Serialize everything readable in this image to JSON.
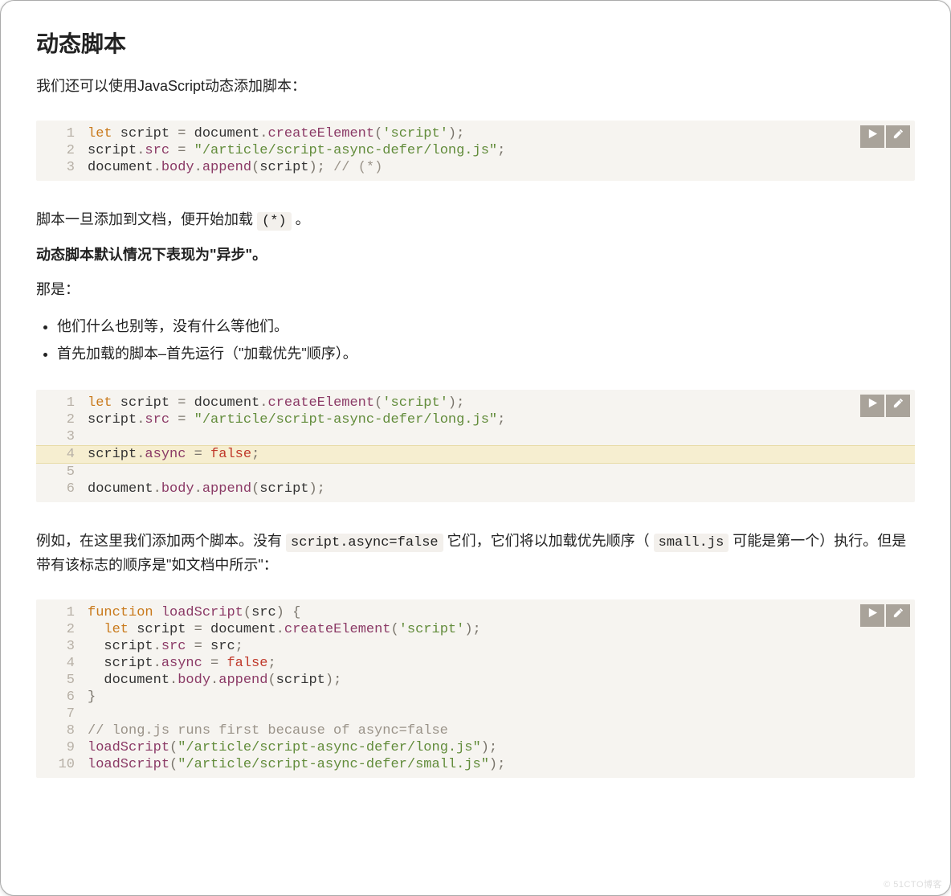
{
  "title": "动态脚本",
  "intro": "我们还可以使用JavaScript动态添加脚本：",
  "code1": {
    "lines": [
      {
        "n": "1",
        "tokens": [
          [
            "kw",
            "let"
          ],
          [
            "id",
            " script "
          ],
          [
            "punc",
            "="
          ],
          [
            "id",
            " document"
          ],
          [
            "punc",
            "."
          ],
          [
            "func",
            "createElement"
          ],
          [
            "punc",
            "("
          ],
          [
            "str",
            "'script'"
          ],
          [
            "punc",
            ");"
          ]
        ]
      },
      {
        "n": "2",
        "tokens": [
          [
            "id",
            "script"
          ],
          [
            "punc",
            "."
          ],
          [
            "prop",
            "src"
          ],
          [
            "id",
            " "
          ],
          [
            "punc",
            "="
          ],
          [
            "id",
            " "
          ],
          [
            "str",
            "\"/article/script-async-defer/long.js\""
          ],
          [
            "punc",
            ";"
          ]
        ]
      },
      {
        "n": "3",
        "tokens": [
          [
            "id",
            "document"
          ],
          [
            "punc",
            "."
          ],
          [
            "prop",
            "body"
          ],
          [
            "punc",
            "."
          ],
          [
            "func",
            "append"
          ],
          [
            "punc",
            "("
          ],
          [
            "id",
            "script"
          ],
          [
            "punc",
            ");"
          ],
          [
            "id",
            " "
          ],
          [
            "cmt",
            "// (*)"
          ]
        ]
      }
    ]
  },
  "p2_pre": "脚本一旦添加到文档，便开始加载 ",
  "p2_code": "(*)",
  "p2_post": " 。",
  "p3": "动态脚本默认情况下表现为\"异步\"。",
  "p4": "那是：",
  "bullets": [
    "他们什么也别等，没有什么等他们。",
    "首先加载的脚本–首先运行（\"加载优先\"顺序）。"
  ],
  "code2": {
    "lines": [
      {
        "n": "1",
        "tokens": [
          [
            "kw",
            "let"
          ],
          [
            "id",
            " script "
          ],
          [
            "punc",
            "="
          ],
          [
            "id",
            " document"
          ],
          [
            "punc",
            "."
          ],
          [
            "func",
            "createElement"
          ],
          [
            "punc",
            "("
          ],
          [
            "str",
            "'script'"
          ],
          [
            "punc",
            ");"
          ]
        ]
      },
      {
        "n": "2",
        "tokens": [
          [
            "id",
            "script"
          ],
          [
            "punc",
            "."
          ],
          [
            "prop",
            "src"
          ],
          [
            "id",
            " "
          ],
          [
            "punc",
            "="
          ],
          [
            "id",
            " "
          ],
          [
            "str",
            "\"/article/script-async-defer/long.js\""
          ],
          [
            "punc",
            ";"
          ]
        ]
      },
      {
        "n": "3",
        "tokens": []
      },
      {
        "n": "4",
        "hl": true,
        "tokens": [
          [
            "id",
            "script"
          ],
          [
            "punc",
            "."
          ],
          [
            "prop",
            "async"
          ],
          [
            "id",
            " "
          ],
          [
            "punc",
            "="
          ],
          [
            "id",
            " "
          ],
          [
            "bool",
            "false"
          ],
          [
            "punc",
            ";"
          ]
        ]
      },
      {
        "n": "5",
        "tokens": []
      },
      {
        "n": "6",
        "tokens": [
          [
            "id",
            "document"
          ],
          [
            "punc",
            "."
          ],
          [
            "prop",
            "body"
          ],
          [
            "punc",
            "."
          ],
          [
            "func",
            "append"
          ],
          [
            "punc",
            "("
          ],
          [
            "id",
            "script"
          ],
          [
            "punc",
            ");"
          ]
        ]
      }
    ]
  },
  "p5_a": "例如，在这里我们添加两个脚本。没有 ",
  "p5_code1": "script.async=false",
  "p5_b": " 它们，它们将以加载优先顺序（ ",
  "p5_code2": "small.js",
  "p5_c": " 可能是第一个）执行。但是带有该标志的顺序是\"如文档中所示\"：",
  "code3": {
    "lines": [
      {
        "n": "1",
        "tokens": [
          [
            "kw",
            "function"
          ],
          [
            "id",
            " "
          ],
          [
            "func",
            "loadScript"
          ],
          [
            "punc",
            "("
          ],
          [
            "id",
            "src"
          ],
          [
            "punc",
            ")"
          ],
          [
            "id",
            " "
          ],
          [
            "punc",
            "{"
          ]
        ]
      },
      {
        "n": "2",
        "tokens": [
          [
            "id",
            "  "
          ],
          [
            "kw",
            "let"
          ],
          [
            "id",
            " script "
          ],
          [
            "punc",
            "="
          ],
          [
            "id",
            " document"
          ],
          [
            "punc",
            "."
          ],
          [
            "func",
            "createElement"
          ],
          [
            "punc",
            "("
          ],
          [
            "str",
            "'script'"
          ],
          [
            "punc",
            ");"
          ]
        ]
      },
      {
        "n": "3",
        "tokens": [
          [
            "id",
            "  script"
          ],
          [
            "punc",
            "."
          ],
          [
            "prop",
            "src"
          ],
          [
            "id",
            " "
          ],
          [
            "punc",
            "="
          ],
          [
            "id",
            " src"
          ],
          [
            "punc",
            ";"
          ]
        ]
      },
      {
        "n": "4",
        "tokens": [
          [
            "id",
            "  script"
          ],
          [
            "punc",
            "."
          ],
          [
            "prop",
            "async"
          ],
          [
            "id",
            " "
          ],
          [
            "punc",
            "="
          ],
          [
            "id",
            " "
          ],
          [
            "bool",
            "false"
          ],
          [
            "punc",
            ";"
          ]
        ]
      },
      {
        "n": "5",
        "tokens": [
          [
            "id",
            "  document"
          ],
          [
            "punc",
            "."
          ],
          [
            "prop",
            "body"
          ],
          [
            "punc",
            "."
          ],
          [
            "func",
            "append"
          ],
          [
            "punc",
            "("
          ],
          [
            "id",
            "script"
          ],
          [
            "punc",
            ");"
          ]
        ]
      },
      {
        "n": "6",
        "tokens": [
          [
            "punc",
            "}"
          ]
        ]
      },
      {
        "n": "7",
        "tokens": []
      },
      {
        "n": "8",
        "tokens": [
          [
            "cmt",
            "// long.js runs first because of async=false"
          ]
        ]
      },
      {
        "n": "9",
        "tokens": [
          [
            "func",
            "loadScript"
          ],
          [
            "punc",
            "("
          ],
          [
            "str",
            "\"/article/script-async-defer/long.js\""
          ],
          [
            "punc",
            ");"
          ]
        ]
      },
      {
        "n": "10",
        "tokens": [
          [
            "func",
            "loadScript"
          ],
          [
            "punc",
            "("
          ],
          [
            "str",
            "\"/article/script-async-defer/small.js\""
          ],
          [
            "punc",
            ");"
          ]
        ]
      }
    ]
  },
  "watermark": "© 51CTO博客"
}
